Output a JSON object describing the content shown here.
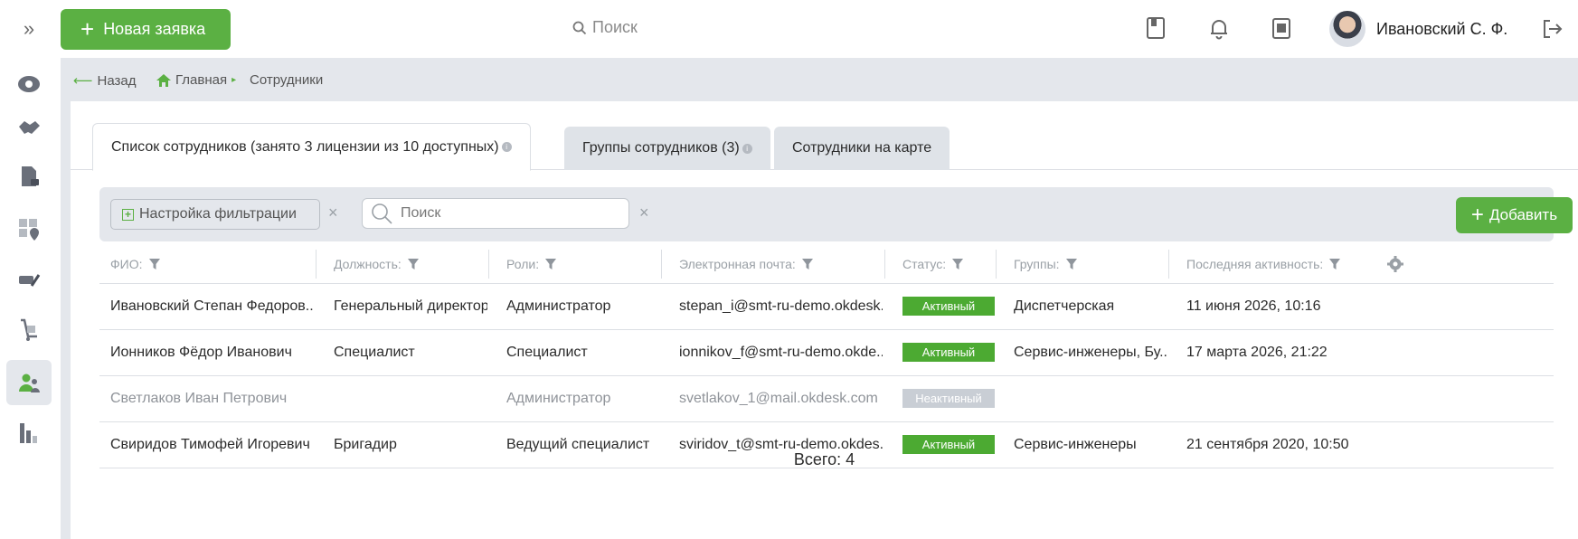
{
  "header": {
    "collapse_icon": "»",
    "new_ticket_label": "Новая заявка",
    "search_placeholder": "Поиск",
    "user_name": "Ивановский С. Ф."
  },
  "breadcrumb": {
    "back": "Назад",
    "home": "Главная",
    "current": "Сотрудники"
  },
  "tabs": [
    {
      "label": "Список сотрудников (занято 3 лицензии из 10 доступных)",
      "info": "i"
    },
    {
      "label": "Группы сотрудников (3)",
      "info": "i"
    },
    {
      "label": "Сотрудники на карте"
    }
  ],
  "toolbar": {
    "filter_label": "Настройка фильтрации",
    "search_placeholder": "Поиск",
    "add_label": "Добавить",
    "clear_icon": "×"
  },
  "table": {
    "columns": [
      "ФИО:",
      "Должность:",
      "Роли:",
      "Электронная почта:",
      "Статус:",
      "Группы:",
      "Последняя активность:"
    ],
    "rows": [
      {
        "name": "Ивановский Степан Федоров...",
        "position": "Генеральный директор",
        "role": "Администратор",
        "email": "stepan_i@smt-ru-demo.okdesk...",
        "status": "Активный",
        "groups": "Диспетчерская",
        "last_activity": "11 июня 2026, 10:16",
        "active": true
      },
      {
        "name": "Ионников Фёдор Иванович",
        "position": "Специалист",
        "role": "Специалист",
        "email": "ionnikov_f@smt-ru-demo.okde...",
        "status": "Активный",
        "groups": "Сервис-инженеры, Бу...",
        "last_activity": "17 марта 2026, 21:22",
        "active": true
      },
      {
        "name": "Светлаков Иван Петрович",
        "position": "",
        "role": "Администратор",
        "email": "svetlakov_1@mail.okdesk.com",
        "status": "Неактивный",
        "groups": "",
        "last_activity": "",
        "active": false
      },
      {
        "name": "Свиридов Тимофей Игоревич",
        "position": "Бригадир",
        "role": "Ведущий специалист",
        "email": "sviridov_t@smt-ru-demo.okdes...",
        "status": "Активный",
        "groups": "Сервис-инженеры",
        "last_activity": "21 сентября 2020, 10:50",
        "active": true
      }
    ]
  },
  "footer": {
    "total": "Всего: 4"
  },
  "colors": {
    "accent": "#5bb043",
    "active_badge": "#4caa32",
    "inactive_badge": "#c9ced5",
    "band": "#e4e7ec"
  }
}
